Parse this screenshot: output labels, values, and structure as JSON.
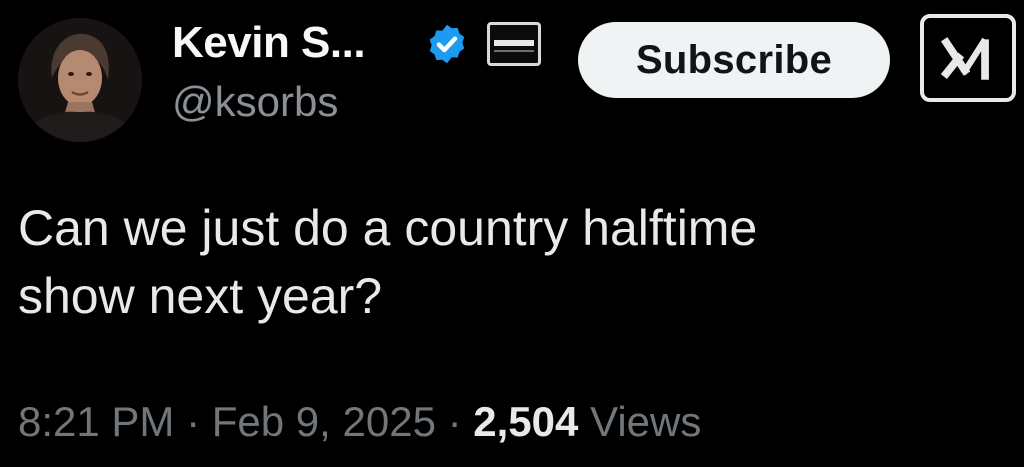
{
  "author": {
    "display_name": "Kevin S...",
    "handle": "@ksorbs",
    "avatar_icon": "profile-photo",
    "verified_icon": "verified-badge-icon",
    "verified_color": "#1d9bf0",
    "affiliation_icon": "affiliation-badge-icon"
  },
  "actions": {
    "subscribe_label": "Subscribe",
    "grok_icon": "grok-icon"
  },
  "tweet": {
    "lines": [
      "Can we just do a country halftime",
      "show next year?"
    ]
  },
  "meta": {
    "time": "8:21 PM",
    "separator": "·",
    "date": "Feb 9, 2025",
    "views_count": "2,504",
    "views_label": "Views"
  },
  "colors": {
    "background": "#000000",
    "text": "#e7e9ea",
    "muted": "#71767b",
    "accent": "#1d9bf0"
  }
}
